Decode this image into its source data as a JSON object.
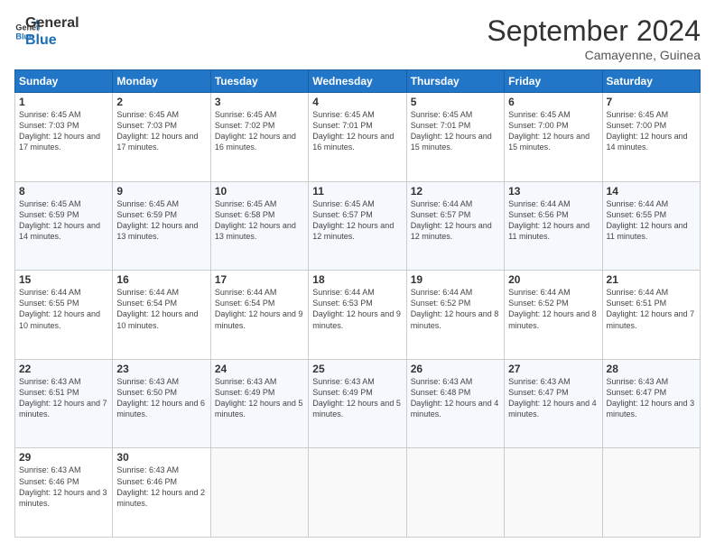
{
  "logo": {
    "line1": "General",
    "line2": "Blue"
  },
  "header": {
    "month": "September 2024",
    "location": "Camayenne, Guinea"
  },
  "days_of_week": [
    "Sunday",
    "Monday",
    "Tuesday",
    "Wednesday",
    "Thursday",
    "Friday",
    "Saturday"
  ],
  "weeks": [
    [
      {
        "day": "1",
        "sunrise": "6:45 AM",
        "sunset": "7:03 PM",
        "daylight": "12 hours and 17 minutes."
      },
      {
        "day": "2",
        "sunrise": "6:45 AM",
        "sunset": "7:03 PM",
        "daylight": "12 hours and 17 minutes."
      },
      {
        "day": "3",
        "sunrise": "6:45 AM",
        "sunset": "7:02 PM",
        "daylight": "12 hours and 16 minutes."
      },
      {
        "day": "4",
        "sunrise": "6:45 AM",
        "sunset": "7:01 PM",
        "daylight": "12 hours and 16 minutes."
      },
      {
        "day": "5",
        "sunrise": "6:45 AM",
        "sunset": "7:01 PM",
        "daylight": "12 hours and 15 minutes."
      },
      {
        "day": "6",
        "sunrise": "6:45 AM",
        "sunset": "7:00 PM",
        "daylight": "12 hours and 15 minutes."
      },
      {
        "day": "7",
        "sunrise": "6:45 AM",
        "sunset": "7:00 PM",
        "daylight": "12 hours and 14 minutes."
      }
    ],
    [
      {
        "day": "8",
        "sunrise": "6:45 AM",
        "sunset": "6:59 PM",
        "daylight": "12 hours and 14 minutes."
      },
      {
        "day": "9",
        "sunrise": "6:45 AM",
        "sunset": "6:59 PM",
        "daylight": "12 hours and 13 minutes."
      },
      {
        "day": "10",
        "sunrise": "6:45 AM",
        "sunset": "6:58 PM",
        "daylight": "12 hours and 13 minutes."
      },
      {
        "day": "11",
        "sunrise": "6:45 AM",
        "sunset": "6:57 PM",
        "daylight": "12 hours and 12 minutes."
      },
      {
        "day": "12",
        "sunrise": "6:44 AM",
        "sunset": "6:57 PM",
        "daylight": "12 hours and 12 minutes."
      },
      {
        "day": "13",
        "sunrise": "6:44 AM",
        "sunset": "6:56 PM",
        "daylight": "12 hours and 11 minutes."
      },
      {
        "day": "14",
        "sunrise": "6:44 AM",
        "sunset": "6:55 PM",
        "daylight": "12 hours and 11 minutes."
      }
    ],
    [
      {
        "day": "15",
        "sunrise": "6:44 AM",
        "sunset": "6:55 PM",
        "daylight": "12 hours and 10 minutes."
      },
      {
        "day": "16",
        "sunrise": "6:44 AM",
        "sunset": "6:54 PM",
        "daylight": "12 hours and 10 minutes."
      },
      {
        "day": "17",
        "sunrise": "6:44 AM",
        "sunset": "6:54 PM",
        "daylight": "12 hours and 9 minutes."
      },
      {
        "day": "18",
        "sunrise": "6:44 AM",
        "sunset": "6:53 PM",
        "daylight": "12 hours and 9 minutes."
      },
      {
        "day": "19",
        "sunrise": "6:44 AM",
        "sunset": "6:52 PM",
        "daylight": "12 hours and 8 minutes."
      },
      {
        "day": "20",
        "sunrise": "6:44 AM",
        "sunset": "6:52 PM",
        "daylight": "12 hours and 8 minutes."
      },
      {
        "day": "21",
        "sunrise": "6:44 AM",
        "sunset": "6:51 PM",
        "daylight": "12 hours and 7 minutes."
      }
    ],
    [
      {
        "day": "22",
        "sunrise": "6:43 AM",
        "sunset": "6:51 PM",
        "daylight": "12 hours and 7 minutes."
      },
      {
        "day": "23",
        "sunrise": "6:43 AM",
        "sunset": "6:50 PM",
        "daylight": "12 hours and 6 minutes."
      },
      {
        "day": "24",
        "sunrise": "6:43 AM",
        "sunset": "6:49 PM",
        "daylight": "12 hours and 5 minutes."
      },
      {
        "day": "25",
        "sunrise": "6:43 AM",
        "sunset": "6:49 PM",
        "daylight": "12 hours and 5 minutes."
      },
      {
        "day": "26",
        "sunrise": "6:43 AM",
        "sunset": "6:48 PM",
        "daylight": "12 hours and 4 minutes."
      },
      {
        "day": "27",
        "sunrise": "6:43 AM",
        "sunset": "6:47 PM",
        "daylight": "12 hours and 4 minutes."
      },
      {
        "day": "28",
        "sunrise": "6:43 AM",
        "sunset": "6:47 PM",
        "daylight": "12 hours and 3 minutes."
      }
    ],
    [
      {
        "day": "29",
        "sunrise": "6:43 AM",
        "sunset": "6:46 PM",
        "daylight": "12 hours and 3 minutes."
      },
      {
        "day": "30",
        "sunrise": "6:43 AM",
        "sunset": "6:46 PM",
        "daylight": "12 hours and 2 minutes."
      },
      null,
      null,
      null,
      null,
      null
    ]
  ],
  "labels": {
    "sunrise": "Sunrise:",
    "sunset": "Sunset:",
    "daylight": "Daylight:"
  }
}
